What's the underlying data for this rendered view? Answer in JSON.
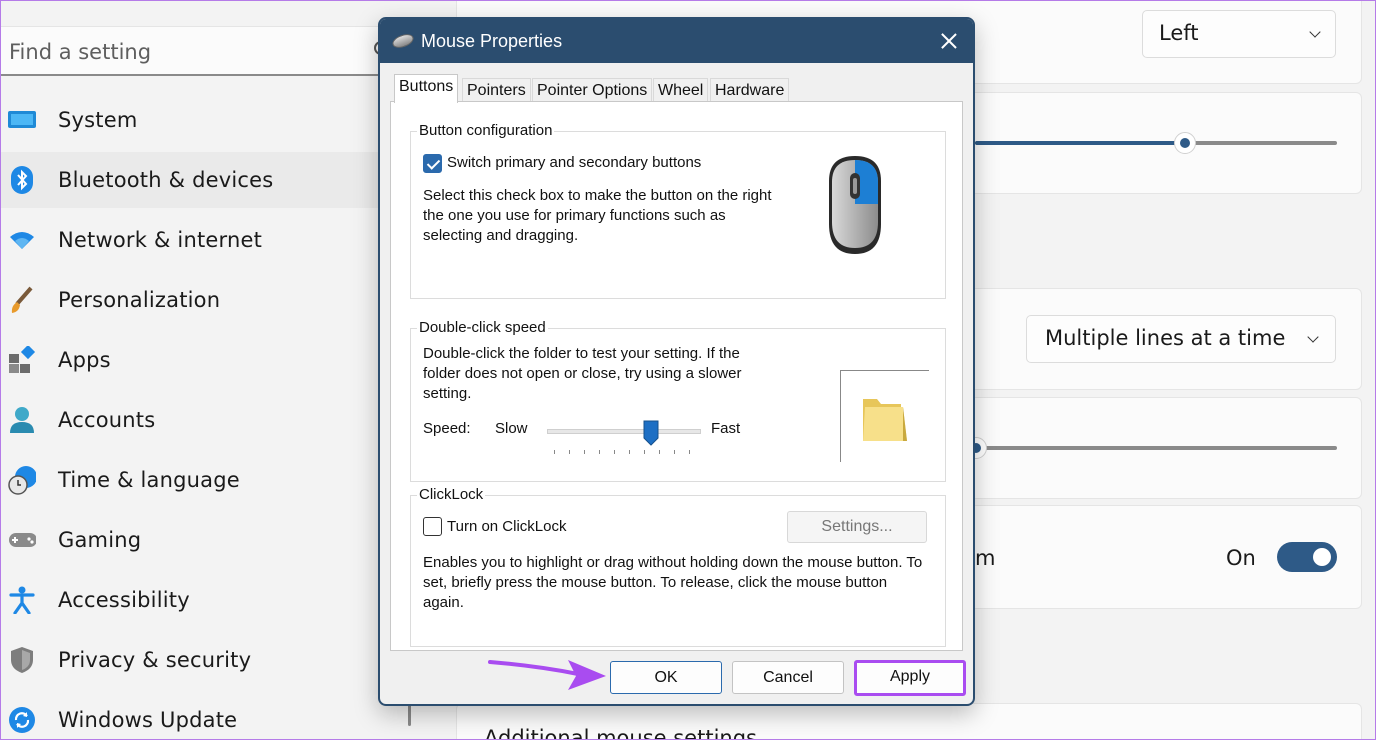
{
  "sidebar": {
    "search_placeholder": "Find a setting",
    "items": [
      {
        "label": "System",
        "icon": "monitor-icon"
      },
      {
        "label": "Bluetooth & devices",
        "icon": "bluetooth-icon"
      },
      {
        "label": "Network & internet",
        "icon": "wifi-icon"
      },
      {
        "label": "Personalization",
        "icon": "brush-icon"
      },
      {
        "label": "Apps",
        "icon": "apps-icon"
      },
      {
        "label": "Accounts",
        "icon": "person-icon"
      },
      {
        "label": "Time & language",
        "icon": "globe-clock-icon"
      },
      {
        "label": "Gaming",
        "icon": "gamepad-icon"
      },
      {
        "label": "Accessibility",
        "icon": "accessibility-icon"
      },
      {
        "label": "Privacy & security",
        "icon": "shield-icon"
      },
      {
        "label": "Windows Update",
        "icon": "update-icon"
      }
    ],
    "selected": "Bluetooth & devices"
  },
  "main": {
    "primary_button_value": "Left",
    "scroll_mode_value": "Multiple lines at a time",
    "toggle_partial_label": "m",
    "toggle_state": "On",
    "bottom_partial_text": "Additional mouse settings"
  },
  "dialog": {
    "title": "Mouse Properties",
    "tabs": [
      "Buttons",
      "Pointers",
      "Pointer Options",
      "Wheel",
      "Hardware"
    ],
    "active_tab": "Buttons",
    "button_config": {
      "legend": "Button configuration",
      "checkbox_label": "Switch primary and secondary buttons",
      "checked": true,
      "description": "Select this check box to make the button on the right the one you use for primary functions such as selecting and dragging."
    },
    "double_click": {
      "legend": "Double-click speed",
      "description": "Double-click the folder to test your setting. If the folder does not open or close, try using a slower setting.",
      "speed_label": "Speed:",
      "slow_label": "Slow",
      "fast_label": "Fast",
      "slider_level": 0.67
    },
    "clicklock": {
      "legend": "ClickLock",
      "checkbox_label": "Turn on ClickLock",
      "checked": false,
      "settings_button": "Settings...",
      "description": "Enables you to highlight or drag without holding down the mouse button. To set, briefly press the mouse button. To release, click the mouse button again."
    },
    "buttons": {
      "ok": "OK",
      "cancel": "Cancel",
      "apply": "Apply"
    }
  },
  "colors": {
    "accent": "#2b4d6f",
    "highlight": "#a94cf0",
    "checkbox": "#2b6aad"
  }
}
